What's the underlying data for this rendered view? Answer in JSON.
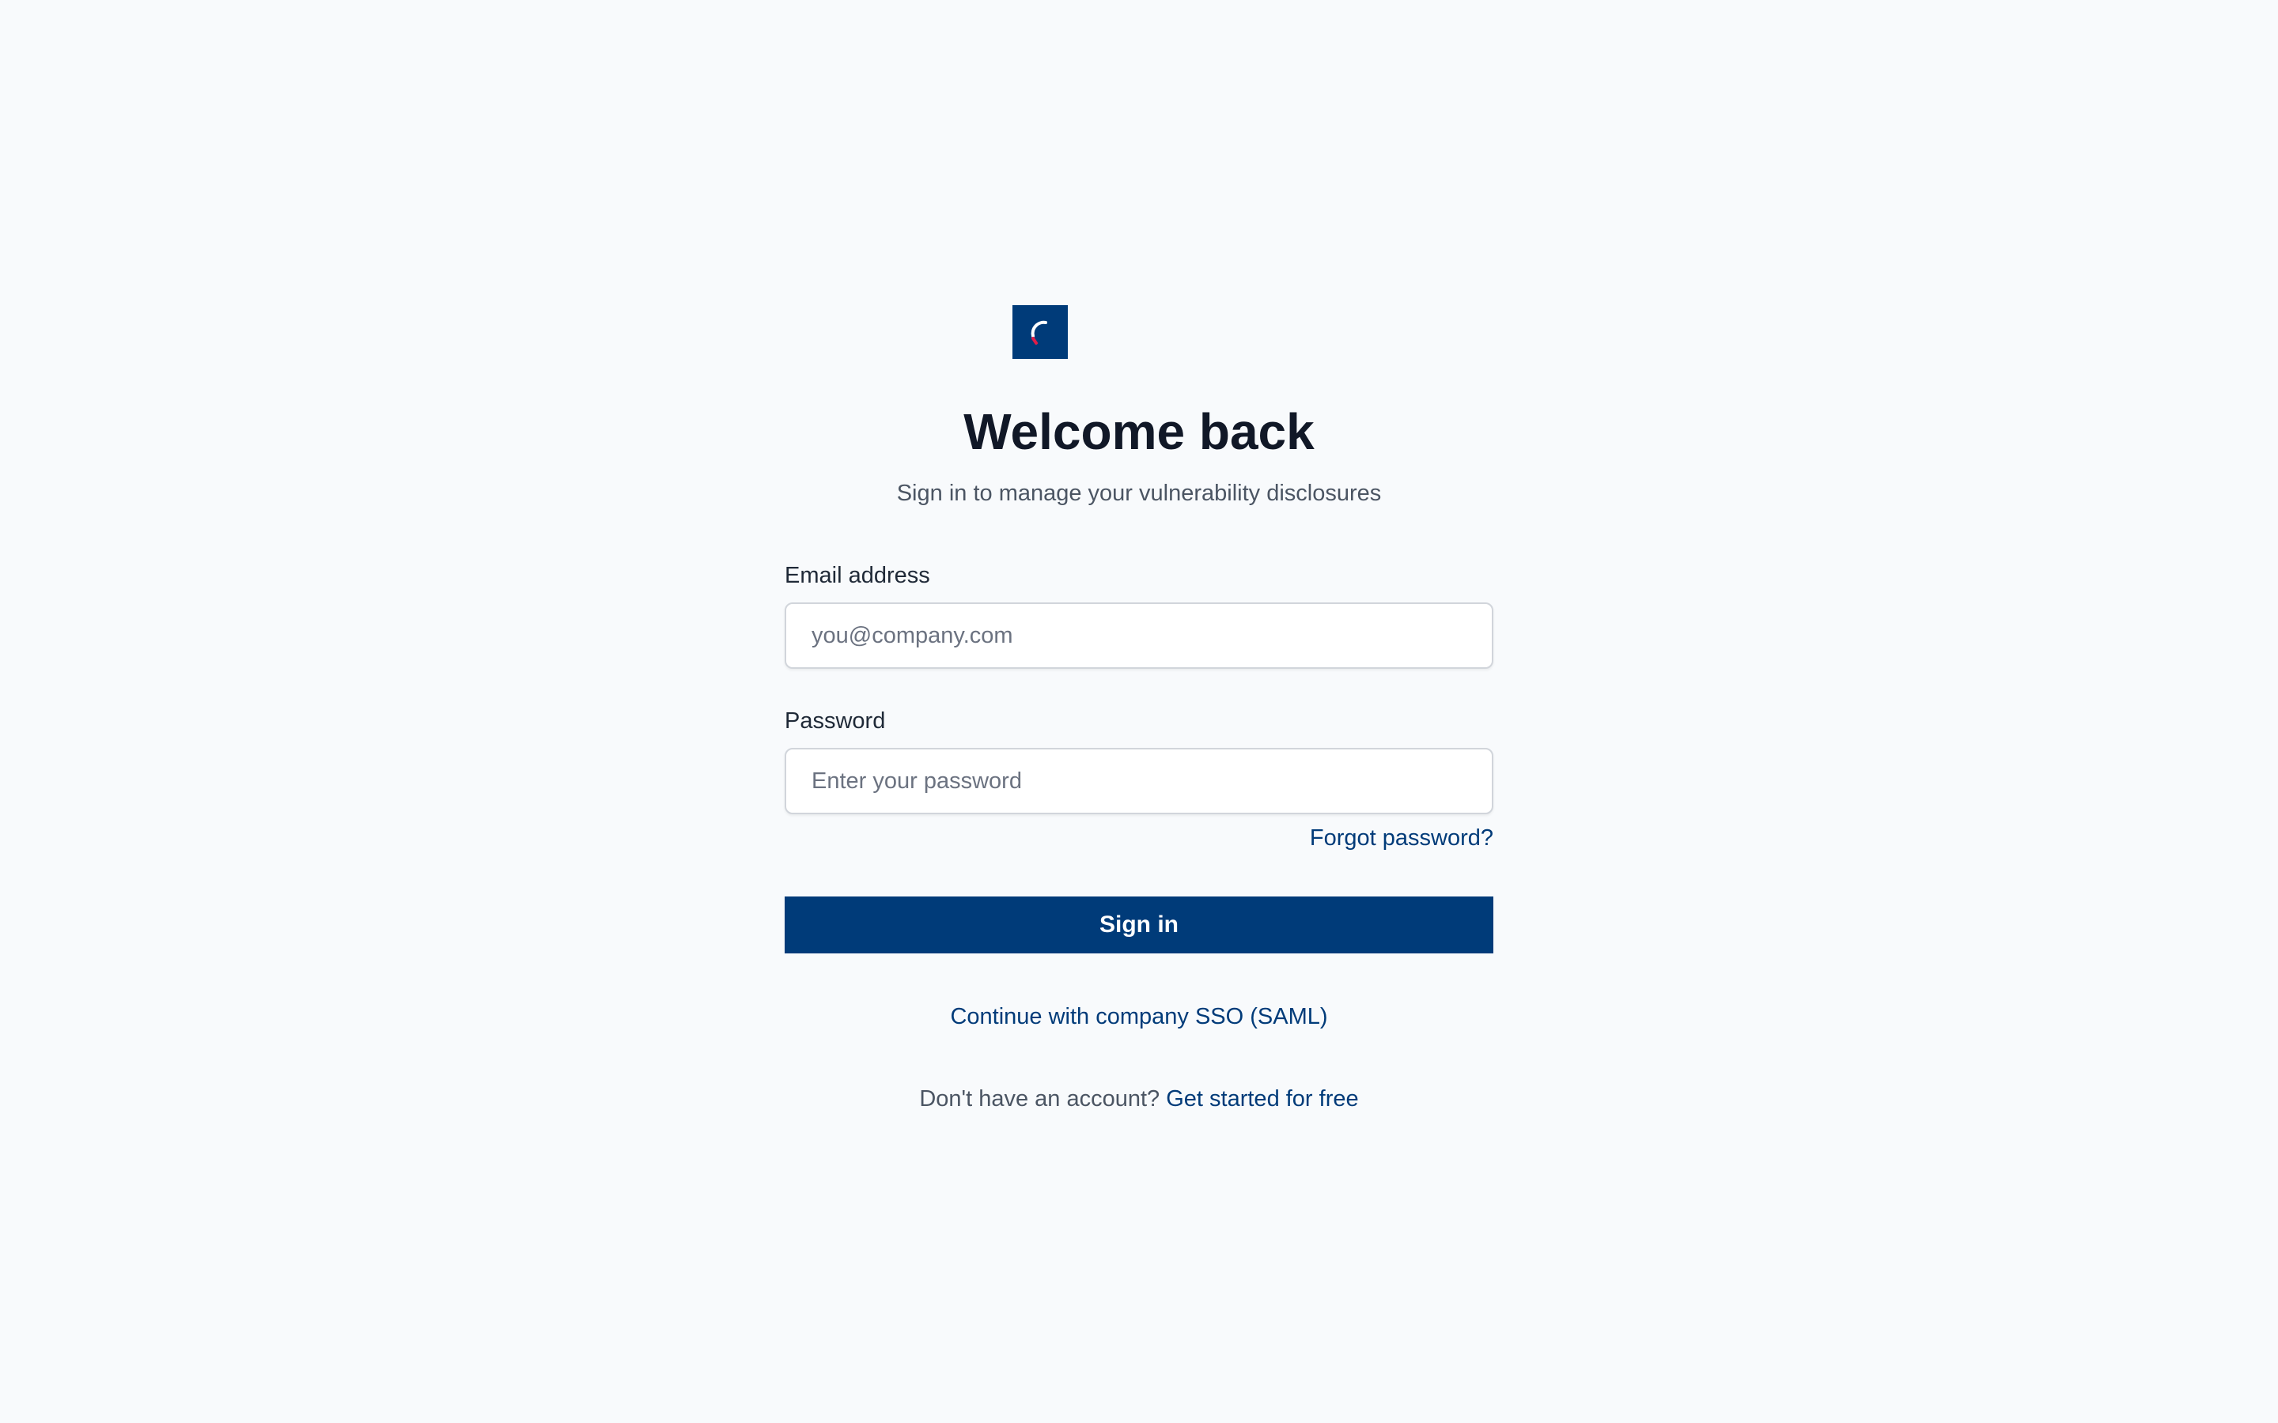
{
  "brand": {
    "logo_icon": "brand-logo-icon",
    "primary_color": "#003b79"
  },
  "header": {
    "title": "Welcome back",
    "subtitle": "Sign in to manage your vulnerability disclosures"
  },
  "form": {
    "email": {
      "label": "Email address",
      "placeholder": "you@company.com",
      "value": ""
    },
    "password": {
      "label": "Password",
      "placeholder": "Enter your password",
      "value": ""
    },
    "forgot_label": "Forgot password?",
    "submit_label": "Sign in"
  },
  "sso": {
    "label": "Continue with company SSO (SAML)"
  },
  "signup": {
    "prompt": "Don't have an account?",
    "link_label": "Get started for free"
  }
}
